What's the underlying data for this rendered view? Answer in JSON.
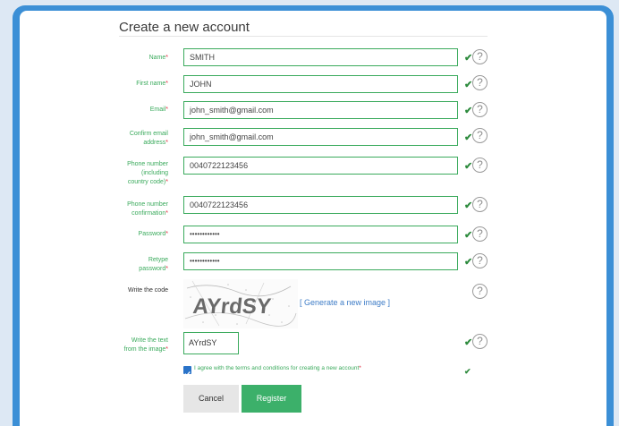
{
  "form": {
    "title": "Create a new account",
    "fields": [
      {
        "label": "Name",
        "value": "SMITH",
        "type": "text",
        "valid": true
      },
      {
        "label": "First name",
        "value": "JOHN",
        "type": "text",
        "valid": true
      },
      {
        "label": "Email",
        "value": "john_smith@gmail.com",
        "type": "text",
        "valid": true
      },
      {
        "label_lines": [
          "Confirm email",
          "address"
        ],
        "value": "john_smith@gmail.com",
        "type": "text",
        "valid": true
      },
      {
        "label_lines": [
          "Phone number",
          "(including",
          "country code)"
        ],
        "value": "0040722123456",
        "type": "text",
        "valid": true
      },
      {
        "label_lines": [
          "Phone number",
          "confirmation"
        ],
        "value": "0040722123456",
        "type": "text",
        "valid": true
      },
      {
        "label": "Password",
        "value": "••••••••••••",
        "type": "password",
        "valid": true
      },
      {
        "label_lines": [
          "Retype",
          "password"
        ],
        "value": "••••••••••••",
        "type": "password",
        "valid": true
      }
    ],
    "required_mark": "*",
    "check_glyph": "✔",
    "help_glyph": "?",
    "captcha": {
      "label": "Write the code",
      "image_text": "AYrdSY",
      "generate_link": "[ Generate a new image ]"
    },
    "code_field": {
      "label_lines": [
        "Write the text",
        "from the image"
      ],
      "value": "AYrdSY"
    },
    "terms": {
      "text": "I agree with the terms and conditions for creating a new account",
      "checked": true
    },
    "buttons": {
      "cancel": "Cancel",
      "register": "Register"
    }
  },
  "colors": {
    "frame": "#3b8fd6",
    "label_green": "#3aaa5c",
    "required_red": "#e0263a",
    "register_green": "#3cb06a",
    "link_blue": "#3f7dc7"
  },
  "icons": [
    "check-icon",
    "help-icon",
    "checkbox-checked-icon"
  ]
}
